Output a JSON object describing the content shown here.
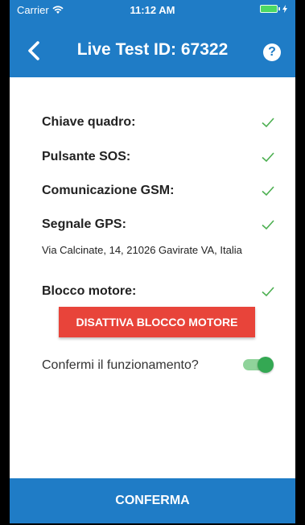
{
  "status_bar": {
    "carrier": "Carrier",
    "time": "11:12 AM"
  },
  "nav": {
    "title": "Live Test ID: 67322",
    "help_glyph": "?"
  },
  "checks": [
    {
      "label": "Chiave quadro:",
      "status_icon": "checkmark-icon"
    },
    {
      "label": "Pulsante SOS:",
      "status_icon": "checkmark-icon"
    },
    {
      "label": "Comunicazione GSM:",
      "status_icon": "checkmark-icon"
    },
    {
      "label": "Segnale GPS:",
      "status_icon": "checkmark-icon"
    },
    {
      "label": "Blocco motore:",
      "status_icon": "checkmark-icon"
    }
  ],
  "gps_address": "Via Calcinate, 14, 21026 Gavirate VA, Italia",
  "engine_block_button": "DISATTIVA BLOCCO MOTORE",
  "confirm": {
    "question": "Confermi il funzionamento?",
    "toggle_on": true
  },
  "footer": {
    "confirm_button": "CONFERMA"
  },
  "colors": {
    "primary": "#1f7cc6",
    "danger": "#e8443a",
    "success": "#4caf50",
    "toggle_on": "#34a853"
  }
}
